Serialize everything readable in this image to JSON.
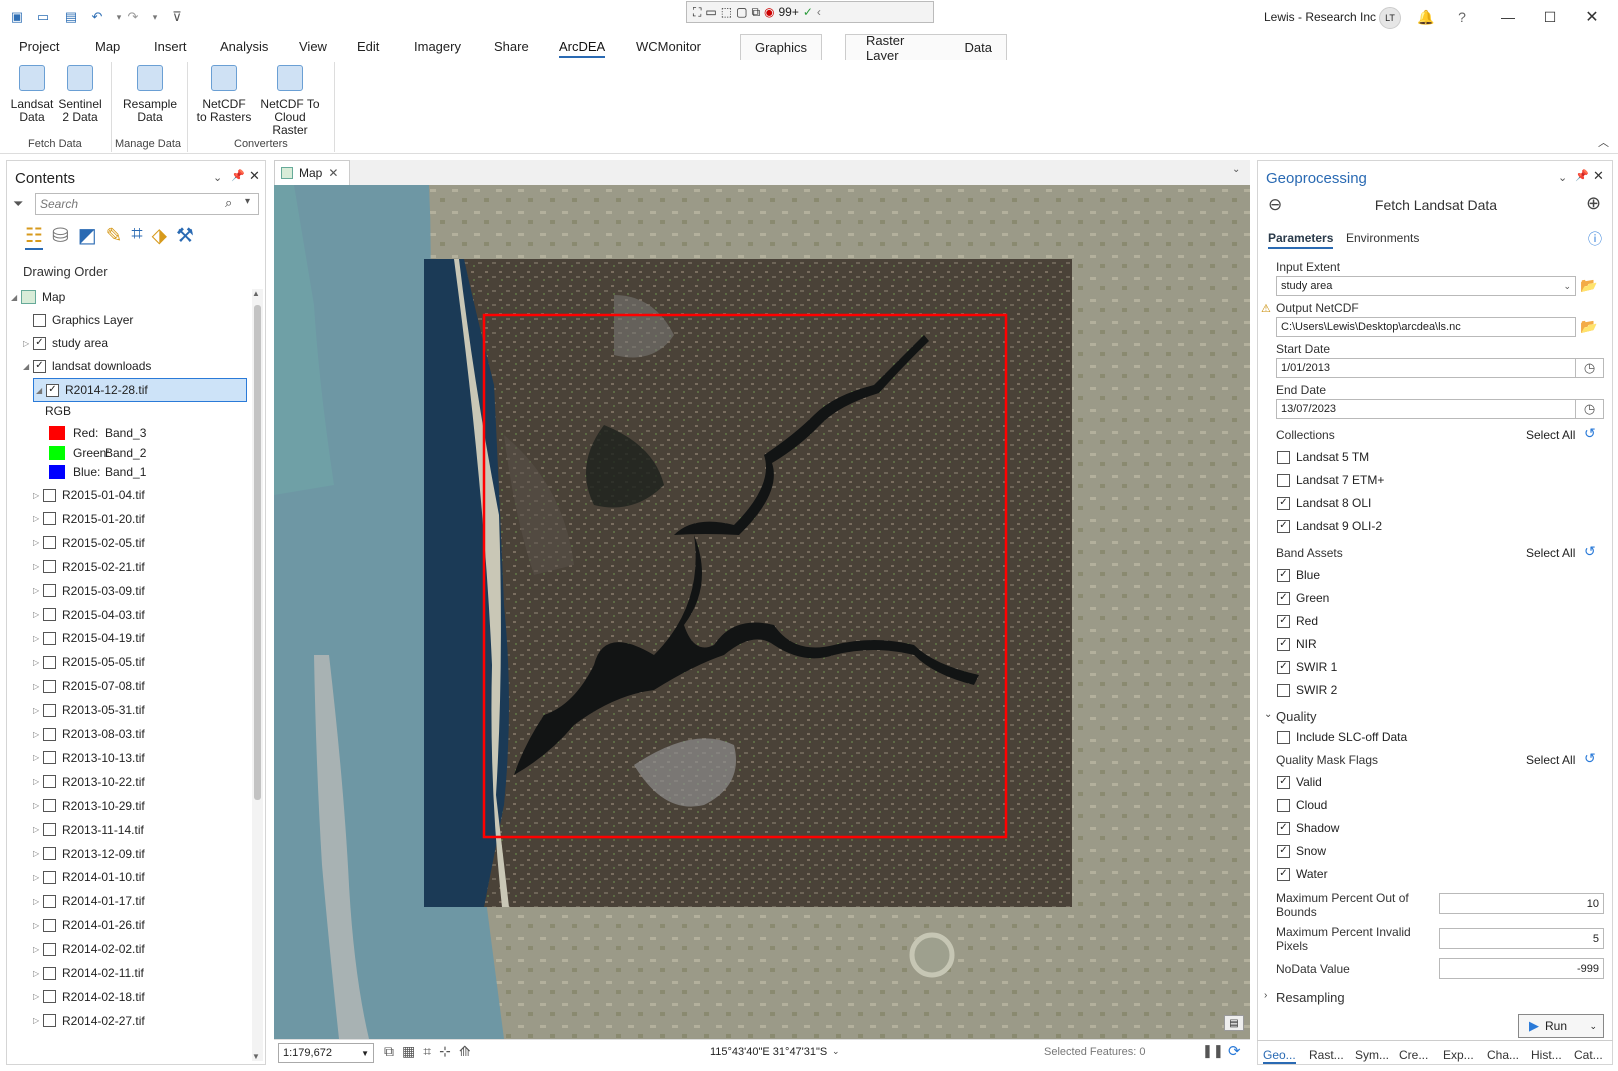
{
  "titlebar": {
    "account": "Lewis - Research Inc",
    "initials": "LT",
    "help": "?",
    "notif_count": "99+"
  },
  "ribbon": {
    "tabs": [
      "Project",
      "Map",
      "Insert",
      "Analysis",
      "View",
      "Edit",
      "Imagery",
      "Share",
      "ArcDEA",
      "WCMonitor"
    ],
    "context_tabs": [
      "Graphics",
      "Raster Layer",
      "Data"
    ],
    "buttons": [
      {
        "l1": "Landsat",
        "l2": "Data"
      },
      {
        "l1": "Sentinel",
        "l2": "2 Data"
      },
      {
        "l1": "Resample",
        "l2": "Data"
      },
      {
        "l1": "NetCDF",
        "l2": "to Rasters"
      },
      {
        "l1": "NetCDF To",
        "l2": "Cloud Raster"
      }
    ],
    "groups": [
      "Fetch Data",
      "Manage Data",
      "Converters"
    ]
  },
  "contents": {
    "title": "Contents",
    "search_placeholder": "Search",
    "drawing_order": "Drawing Order",
    "map": "Map",
    "graphics_layer": "Graphics Layer",
    "study_area": "study area",
    "landsat_downloads": "landsat downloads",
    "selected": "R2014-12-28.tif",
    "rgb": "RGB",
    "bands": [
      {
        "ch": "Red:",
        "band": "Band_3",
        "color": "#ff0000"
      },
      {
        "ch": "Green:",
        "band": "Band_2",
        "color": "#00ff00"
      },
      {
        "ch": "Blue:",
        "band": "Band_1",
        "color": "#0000ff"
      }
    ],
    "rasters": [
      "R2015-01-04.tif",
      "R2015-01-20.tif",
      "R2015-02-05.tif",
      "R2015-02-21.tif",
      "R2015-03-09.tif",
      "R2015-04-03.tif",
      "R2015-04-19.tif",
      "R2015-05-05.tif",
      "R2015-07-08.tif",
      "R2013-05-31.tif",
      "R2013-08-03.tif",
      "R2013-10-13.tif",
      "R2013-10-22.tif",
      "R2013-10-29.tif",
      "R2013-11-14.tif",
      "R2013-12-09.tif",
      "R2014-01-10.tif",
      "R2014-01-17.tif",
      "R2014-01-26.tif",
      "R2014-02-02.tif",
      "R2014-02-11.tif",
      "R2014-02-18.tif",
      "R2014-02-27.tif"
    ]
  },
  "map": {
    "tab": "Map",
    "scale": "1:179,672",
    "coords": "115°43'40\"E 31°47'31\"S",
    "selected_features": "Selected Features: 0"
  },
  "gp": {
    "title": "Geoprocessing",
    "tool": "Fetch Landsat Data",
    "tab_params": "Parameters",
    "tab_env": "Environments",
    "input_extent_label": "Input Extent",
    "input_extent": "study area",
    "output_label": "Output NetCDF",
    "output": "C:\\Users\\Lewis\\Desktop\\arcdea\\ls.nc",
    "start_label": "Start Date",
    "start": "1/01/2013",
    "end_label": "End Date",
    "end": "13/07/2023",
    "collections_label": "Collections",
    "select_all": "Select All",
    "collections": [
      {
        "name": "Landsat 5 TM",
        "checked": false
      },
      {
        "name": "Landsat 7 ETM+",
        "checked": false
      },
      {
        "name": "Landsat 8 OLI",
        "checked": true
      },
      {
        "name": "Landsat 9 OLI-2",
        "checked": true
      }
    ],
    "bands_label": "Band Assets",
    "bands": [
      {
        "name": "Blue",
        "checked": true
      },
      {
        "name": "Green",
        "checked": true
      },
      {
        "name": "Red",
        "checked": true
      },
      {
        "name": "NIR",
        "checked": true
      },
      {
        "name": "SWIR 1",
        "checked": true
      },
      {
        "name": "SWIR 2",
        "checked": false
      }
    ],
    "quality": "Quality",
    "slc": "Include SLC-off Data",
    "mask_label": "Quality Mask Flags",
    "masks": [
      {
        "name": "Valid",
        "checked": true
      },
      {
        "name": "Cloud",
        "checked": false
      },
      {
        "name": "Shadow",
        "checked": true
      },
      {
        "name": "Snow",
        "checked": true
      },
      {
        "name": "Water",
        "checked": true
      }
    ],
    "max_oob_l1": "Maximum Percent Out of",
    "max_oob_l2": "Bounds",
    "max_oob": "10",
    "max_inv_l1": "Maximum Percent Invalid",
    "max_inv_l2": "Pixels",
    "max_inv": "5",
    "nodata_label": "NoData Value",
    "nodata": "-999",
    "resampling": "Resampling",
    "run": "Run",
    "bottom_tabs": [
      "Geo...",
      "Rast...",
      "Sym...",
      "Cre...",
      "Exp...",
      "Cha...",
      "Hist...",
      "Cat..."
    ]
  }
}
